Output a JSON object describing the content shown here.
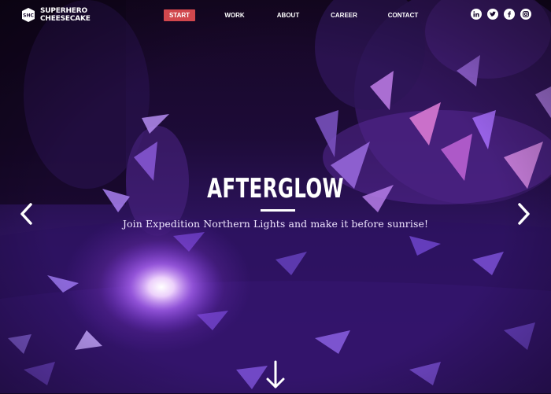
{
  "brand": {
    "line1": "SUPERHERO",
    "line2": "CHEESECAKE",
    "logo_icon": "shc-badge"
  },
  "nav": {
    "items": [
      "START",
      "WORK",
      "ABOUT",
      "CAREER",
      "CONTACT"
    ],
    "active": "START"
  },
  "social": [
    "linkedin-icon",
    "twitter-icon",
    "facebook-icon",
    "instagram-icon"
  ],
  "hero": {
    "title": "AFTERGLOW",
    "subtitle": "Join Expedition Northern Lights and make it before sunrise!"
  },
  "controls": {
    "prev_icon": "chevron-left-icon",
    "next_icon": "chevron-right-icon",
    "scroll_icon": "arrow-down-icon"
  },
  "colors": {
    "active_nav": "#d1474d",
    "accent_purple": "#7a3dff",
    "text": "#ffffff"
  }
}
